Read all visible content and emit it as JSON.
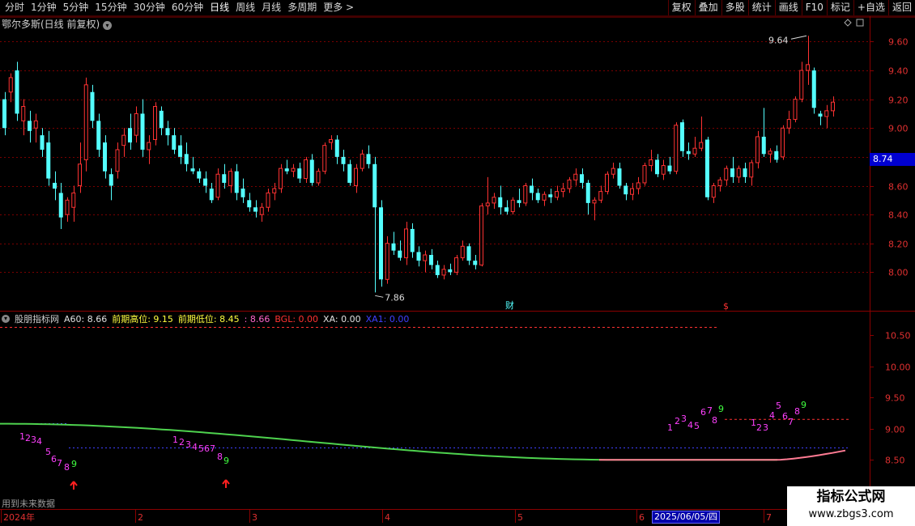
{
  "toolbar": {
    "periods": [
      "分时",
      "1分钟",
      "5分钟",
      "15分钟",
      "30分钟",
      "60分钟",
      "日线",
      "周线",
      "月线",
      "多周期",
      "更多 >"
    ],
    "active_period": "日线",
    "actions": [
      "复权",
      "叠加",
      "多股",
      "统计",
      "画线",
      "F10",
      "标记",
      "+自选",
      "返回"
    ]
  },
  "main": {
    "title": "鄂尔多斯(日线 前复权)",
    "price_axis": [
      "9.60",
      "9.40",
      "9.20",
      "9.00",
      "8.80",
      "8.60",
      "8.40",
      "8.20",
      "8.00"
    ],
    "current_price": "8.74",
    "high_label": "9.64",
    "low_label": "7.86",
    "cai_marker": "财",
    "s_marker": "$"
  },
  "indicator": {
    "name": "股朋指标网",
    "a60": "A60: 8.66",
    "prev_high": "前期高位: 9.15",
    "prev_low": "前期低位: 8.45",
    "blank_value": ": 8.66",
    "bgl": "BGL: 0.00",
    "xa": "XA: 0.00",
    "xa1": "XA1: 0.00",
    "axis": [
      "10.50",
      "10.00",
      "9.50",
      "9.00",
      "8.50",
      "8.00"
    ],
    "future_note": "用到未来数据"
  },
  "x_axis": {
    "labels": [
      "2024年",
      "2",
      "3",
      "4",
      "5",
      "6",
      "7"
    ],
    "selected_date": "2025/06/05/四"
  },
  "colors": {
    "up": "#ff3232",
    "down": "#54ffff",
    "grid": "#7a0000",
    "ma_green": "#4ed24e",
    "ma_pink": "#ff7b93",
    "count_purple": "#ff40ff",
    "count_green": "#40ff40"
  },
  "watermark": {
    "title": "指标公式网",
    "url": "www.zbgs3.com"
  },
  "chart_data": {
    "type": "candlestick",
    "price_range": [
      7.8,
      9.72
    ],
    "candles": [
      [
        9.2,
        9.25,
        8.95,
        9.0
      ],
      [
        9.25,
        9.38,
        9.18,
        9.35
      ],
      [
        9.4,
        9.46,
        9.05,
        9.1
      ],
      [
        9.05,
        9.2,
        8.95,
        9.15
      ],
      [
        9.05,
        9.12,
        8.9,
        8.98
      ],
      [
        9.0,
        9.1,
        8.9,
        9.05
      ],
      [
        8.95,
        9.0,
        8.8,
        8.85
      ],
      [
        8.9,
        8.98,
        8.6,
        8.65
      ],
      [
        8.62,
        8.7,
        8.5,
        8.58
      ],
      [
        8.55,
        8.62,
        8.3,
        8.38
      ],
      [
        8.4,
        8.52,
        8.35,
        8.5
      ],
      [
        8.45,
        8.6,
        8.35,
        8.55
      ],
      [
        8.6,
        8.9,
        8.55,
        8.75
      ],
      [
        8.78,
        9.35,
        8.7,
        9.3
      ],
      [
        9.25,
        9.3,
        9.0,
        9.05
      ],
      [
        9.05,
        9.1,
        8.8,
        8.85
      ],
      [
        8.9,
        8.95,
        8.65,
        8.7
      ],
      [
        8.68,
        8.72,
        8.5,
        8.6
      ],
      [
        8.7,
        8.9,
        8.65,
        8.85
      ],
      [
        8.88,
        9.0,
        8.8,
        8.95
      ],
      [
        9.0,
        9.1,
        8.85,
        8.9
      ],
      [
        8.95,
        9.15,
        8.9,
        9.1
      ],
      [
        9.1,
        9.2,
        8.8,
        8.85
      ],
      [
        8.85,
        8.95,
        8.75,
        8.9
      ],
      [
        8.92,
        9.18,
        8.88,
        9.15
      ],
      [
        9.12,
        9.15,
        8.95,
        9.0
      ],
      [
        9.0,
        9.05,
        8.88,
        8.95
      ],
      [
        8.95,
        9.0,
        8.82,
        8.85
      ],
      [
        8.88,
        8.95,
        8.75,
        8.8
      ],
      [
        8.82,
        8.9,
        8.7,
        8.75
      ],
      [
        8.72,
        8.8,
        8.68,
        8.7
      ],
      [
        8.7,
        8.72,
        8.62,
        8.65
      ],
      [
        8.65,
        8.7,
        8.55,
        8.6
      ],
      [
        8.58,
        8.62,
        8.48,
        8.5
      ],
      [
        8.52,
        8.72,
        8.5,
        8.68
      ],
      [
        8.68,
        8.75,
        8.58,
        8.62
      ],
      [
        8.6,
        8.72,
        8.55,
        8.7
      ],
      [
        8.7,
        8.75,
        8.5,
        8.55
      ],
      [
        8.58,
        8.65,
        8.48,
        8.52
      ],
      [
        8.5,
        8.55,
        8.42,
        8.45
      ],
      [
        8.45,
        8.5,
        8.38,
        8.42
      ],
      [
        8.4,
        8.48,
        8.35,
        8.45
      ],
      [
        8.45,
        8.58,
        8.42,
        8.55
      ],
      [
        8.55,
        8.62,
        8.5,
        8.58
      ],
      [
        8.58,
        8.75,
        8.55,
        8.72
      ],
      [
        8.72,
        8.78,
        8.68,
        8.7
      ],
      [
        8.7,
        8.75,
        8.66,
        8.72
      ],
      [
        8.72,
        8.76,
        8.62,
        8.65
      ],
      [
        8.65,
        8.8,
        8.62,
        8.78
      ],
      [
        8.78,
        8.82,
        8.6,
        8.62
      ],
      [
        8.62,
        8.72,
        8.6,
        8.7
      ],
      [
        8.7,
        8.9,
        8.68,
        8.88
      ],
      [
        8.9,
        8.95,
        8.85,
        8.92
      ],
      [
        8.92,
        8.95,
        8.75,
        8.8
      ],
      [
        8.8,
        8.85,
        8.7,
        8.75
      ],
      [
        8.75,
        8.78,
        8.6,
        8.62
      ],
      [
        8.6,
        8.75,
        8.55,
        8.72
      ],
      [
        8.72,
        8.85,
        8.7,
        8.82
      ],
      [
        8.82,
        8.88,
        8.72,
        8.75
      ],
      [
        8.75,
        8.8,
        7.86,
        8.45
      ],
      [
        8.45,
        8.5,
        7.9,
        7.95
      ],
      [
        7.95,
        8.25,
        7.92,
        8.2
      ],
      [
        8.2,
        8.28,
        8.12,
        8.15
      ],
      [
        8.15,
        8.22,
        8.08,
        8.1
      ],
      [
        8.1,
        8.35,
        8.05,
        8.3
      ],
      [
        8.3,
        8.34,
        8.1,
        8.14
      ],
      [
        8.14,
        8.18,
        8.04,
        8.08
      ],
      [
        8.08,
        8.15,
        8.0,
        8.12
      ],
      [
        8.12,
        8.16,
        8.02,
        8.05
      ],
      [
        8.05,
        8.08,
        7.96,
        7.98
      ],
      [
        7.98,
        8.05,
        7.95,
        8.02
      ],
      [
        8.02,
        8.06,
        7.98,
        8.0
      ],
      [
        8.0,
        8.12,
        7.98,
        8.1
      ],
      [
        8.1,
        8.22,
        8.08,
        8.18
      ],
      [
        8.18,
        8.2,
        8.05,
        8.08
      ],
      [
        8.08,
        8.12,
        8.02,
        8.05
      ],
      [
        8.05,
        8.48,
        8.04,
        8.46
      ],
      [
        8.46,
        8.66,
        8.4,
        8.48
      ],
      [
        8.48,
        8.55,
        8.44,
        8.52
      ],
      [
        8.52,
        8.6,
        8.4,
        8.45
      ],
      [
        8.45,
        8.5,
        8.4,
        8.42
      ],
      [
        8.42,
        8.52,
        8.4,
        8.5
      ],
      [
        8.5,
        8.58,
        8.45,
        8.48
      ],
      [
        8.48,
        8.62,
        8.46,
        8.6
      ],
      [
        8.6,
        8.65,
        8.5,
        8.55
      ],
      [
        8.55,
        8.58,
        8.48,
        8.5
      ],
      [
        8.5,
        8.56,
        8.46,
        8.54
      ],
      [
        8.54,
        8.58,
        8.48,
        8.52
      ],
      [
        8.52,
        8.6,
        8.5,
        8.56
      ],
      [
        8.56,
        8.62,
        8.52,
        8.58
      ],
      [
        8.58,
        8.66,
        8.55,
        8.64
      ],
      [
        8.64,
        8.72,
        8.6,
        8.68
      ],
      [
        8.68,
        8.72,
        8.58,
        8.62
      ],
      [
        8.62,
        8.64,
        8.4,
        8.48
      ],
      [
        8.48,
        8.52,
        8.36,
        8.5
      ],
      [
        8.5,
        8.6,
        8.48,
        8.56
      ],
      [
        8.56,
        8.7,
        8.54,
        8.68
      ],
      [
        8.68,
        8.76,
        8.65,
        8.72
      ],
      [
        8.72,
        8.76,
        8.58,
        8.6
      ],
      [
        8.6,
        8.62,
        8.5,
        8.54
      ],
      [
        8.54,
        8.62,
        8.5,
        8.58
      ],
      [
        8.58,
        8.66,
        8.54,
        8.62
      ],
      [
        8.62,
        8.76,
        8.6,
        8.74
      ],
      [
        8.74,
        8.85,
        8.7,
        8.78
      ],
      [
        8.78,
        8.82,
        8.66,
        8.68
      ],
      [
        8.68,
        8.78,
        8.64,
        8.74
      ],
      [
        8.74,
        8.8,
        8.68,
        8.7
      ],
      [
        8.7,
        9.04,
        8.68,
        9.02
      ],
      [
        9.04,
        9.06,
        8.8,
        8.84
      ],
      [
        8.84,
        8.9,
        8.78,
        8.82
      ],
      [
        8.82,
        8.94,
        8.8,
        8.86
      ],
      [
        8.86,
        9.08,
        8.84,
        8.9
      ],
      [
        8.92,
        8.94,
        8.5,
        8.52
      ],
      [
        8.52,
        8.62,
        8.48,
        8.6
      ],
      [
        8.6,
        8.66,
        8.56,
        8.64
      ],
      [
        8.64,
        8.74,
        8.6,
        8.72
      ],
      [
        8.72,
        8.8,
        8.62,
        8.66
      ],
      [
        8.66,
        8.74,
        8.62,
        8.72
      ],
      [
        8.72,
        8.76,
        8.62,
        8.66
      ],
      [
        8.66,
        8.78,
        8.6,
        8.76
      ],
      [
        8.76,
        8.98,
        8.72,
        8.94
      ],
      [
        8.94,
        9.14,
        8.8,
        8.82
      ],
      [
        8.82,
        8.86,
        8.76,
        8.84
      ],
      [
        8.84,
        8.88,
        8.76,
        8.78
      ],
      [
        8.8,
        9.02,
        8.78,
        9.0
      ],
      [
        9.0,
        9.12,
        8.96,
        9.06
      ],
      [
        9.06,
        9.22,
        9.04,
        9.2
      ],
      [
        9.2,
        9.46,
        9.18,
        9.4
      ],
      [
        9.4,
        9.64,
        9.3,
        9.44
      ],
      [
        9.4,
        9.42,
        9.1,
        9.14
      ],
      [
        9.1,
        9.12,
        9.02,
        9.08
      ],
      [
        9.08,
        9.16,
        9.0,
        9.12
      ],
      [
        9.12,
        9.22,
        9.08,
        9.18
      ]
    ],
    "indicator_line": {
      "segments": [
        {
          "color": "green",
          "from": 9.08,
          "to": 8.5
        },
        {
          "color": "pink",
          "from": 8.5,
          "to": 8.66
        }
      ]
    },
    "count_sequences": [
      {
        "label": "1234 5 6 7 8 9",
        "end_value": 8.08
      },
      {
        "label": "123456789",
        "end_value": 8.18
      },
      {
        "label": "123 45 67 8 9",
        "end_value": 9.15
      },
      {
        "label": "123 4 5 67 8 9",
        "end_value": 9.12
      }
    ],
    "reference_levels": {
      "prev_high": 9.15,
      "prev_low": 8.45
    }
  }
}
